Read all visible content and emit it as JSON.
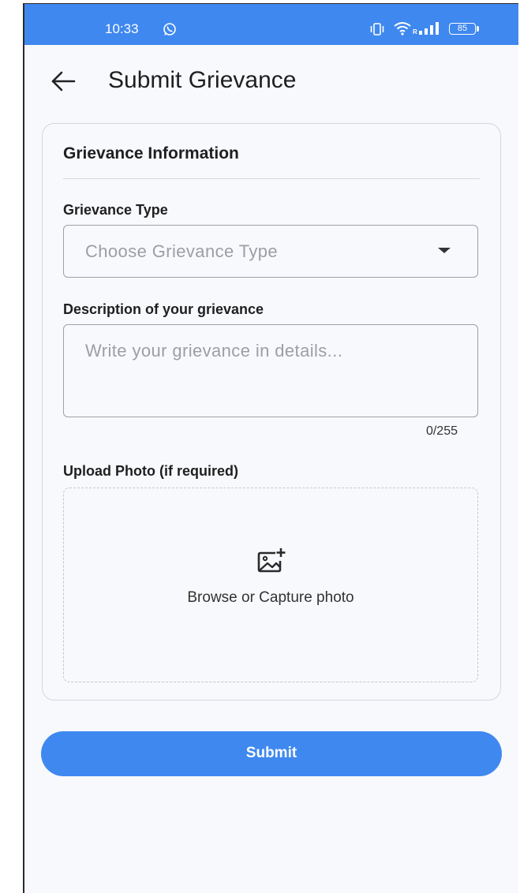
{
  "status_bar": {
    "time": "10:33",
    "network_label": "R",
    "battery": "85",
    "icons": [
      "whatsapp-icon",
      "vibrate-icon",
      "wifi-icon",
      "signal-icon",
      "battery-icon"
    ]
  },
  "header": {
    "title": "Submit Grievance",
    "back_icon": "arrow-left-icon"
  },
  "form": {
    "section_title": "Grievance Information",
    "type_label": "Grievance Type",
    "type_placeholder": "Choose Grievance Type",
    "type_value": "",
    "description_label": "Description of your grievance",
    "description_placeholder": "Write your grievance in details...",
    "description_value": "",
    "char_counter": "0/255",
    "upload_label": "Upload Photo (if required)",
    "upload_prompt": "Browse or Capture photo",
    "upload_icon": "add-photo-icon"
  },
  "submit_label": "Submit",
  "colors": {
    "primary": "#3f88f0",
    "background": "#f8f9fd",
    "border": "#9da1a8",
    "placeholder": "#9b9ea4"
  }
}
